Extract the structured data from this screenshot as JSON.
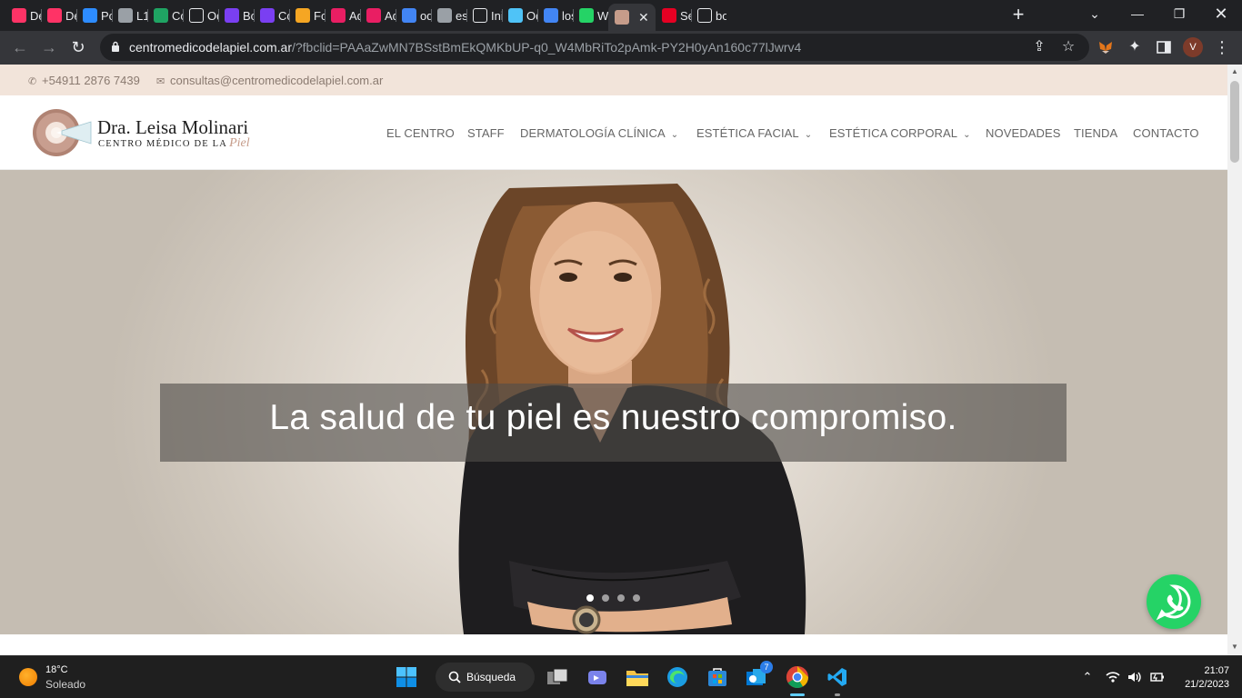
{
  "browser": {
    "tabs": [
      {
        "title": "De",
        "icon": "invision-icon",
        "color": "#ff3366"
      },
      {
        "title": "De",
        "icon": "invision-icon",
        "color": "#ff3366"
      },
      {
        "title": "Po",
        "icon": "zoom-icon",
        "color": "#2d8cff"
      },
      {
        "title": "L1",
        "icon": "globe-icon",
        "color": "#9aa0a6"
      },
      {
        "title": "Co",
        "icon": "google-drive-icon",
        "color": "#1fa463"
      },
      {
        "title": "Od",
        "icon": "a-icon",
        "color": "#ffffff"
      },
      {
        "title": "Bo",
        "icon": "b-icon",
        "color": "#7a3ff2"
      },
      {
        "title": "Co",
        "icon": "b-icon",
        "color": "#7a3ff2"
      },
      {
        "title": "Fo",
        "icon": "shield-icon",
        "color": "#f5a623"
      },
      {
        "title": "Ad",
        "icon": "a-triangle-icon",
        "color": "#e91e63"
      },
      {
        "title": "Ad",
        "icon": "a-triangle-icon",
        "color": "#e91e63"
      },
      {
        "title": "od",
        "icon": "google-icon",
        "color": "#4285f4"
      },
      {
        "title": "esp",
        "icon": "globe-icon",
        "color": "#9aa0a6"
      },
      {
        "title": "Ini",
        "icon": "wix-icon",
        "color": "#ffffff"
      },
      {
        "title": "Od",
        "icon": "people-icon",
        "color": "#4fc3f7"
      },
      {
        "title": "los",
        "icon": "google-icon",
        "color": "#4285f4"
      },
      {
        "title": "Wi",
        "icon": "whatsapp-icon",
        "color": "#25d366"
      },
      {
        "title": "",
        "icon": "centro-medico-icon",
        "color": "#c69c8a",
        "active": true
      },
      {
        "title": "Se",
        "icon": "pin-icon",
        "color": "#e60023"
      },
      {
        "title": "bo",
        "icon": "m-icon",
        "color": "#ffffff"
      }
    ],
    "address": {
      "host": "centromedicodelapiel.com.ar",
      "path": "/?fbclid=PAAaZwMN7BSstBmEkQMKbUP-q0_W4MbRiTo2pAmk-PY2H0yAn160c77lJwrv4"
    },
    "profile_initial": "V"
  },
  "site": {
    "phone": "+54911 2876 7439",
    "email": "consultas@centromedicodelapiel.com.ar",
    "logo": {
      "name": "Dra. Leisa Molinari",
      "subtitle": "CENTRO MÉDICO DE LA",
      "script": "Piel"
    },
    "menu": [
      {
        "label": "EL CENTRO",
        "dropdown": false
      },
      {
        "label": "STAFF",
        "dropdown": false
      },
      {
        "label": "DERMATOLOGÍA CLÍNICA",
        "dropdown": true
      },
      {
        "label": "ESTÉTICA FACIAL",
        "dropdown": true
      },
      {
        "label": "ESTÉTICA CORPORAL",
        "dropdown": true
      },
      {
        "label": "NOVEDADES",
        "dropdown": false
      },
      {
        "label": "TIENDA",
        "dropdown": false
      },
      {
        "label": "CONTACTO",
        "dropdown": false
      }
    ],
    "hero": {
      "caption": "La salud de tu piel es nuestro compromiso.",
      "slides_count": 4,
      "active_slide": 1
    }
  },
  "taskbar": {
    "weather_temp": "18°C",
    "weather_desc": "Soleado",
    "search_label": "Búsqueda",
    "mail_badge": "7",
    "time": "21:07",
    "date": "21/2/2023"
  }
}
